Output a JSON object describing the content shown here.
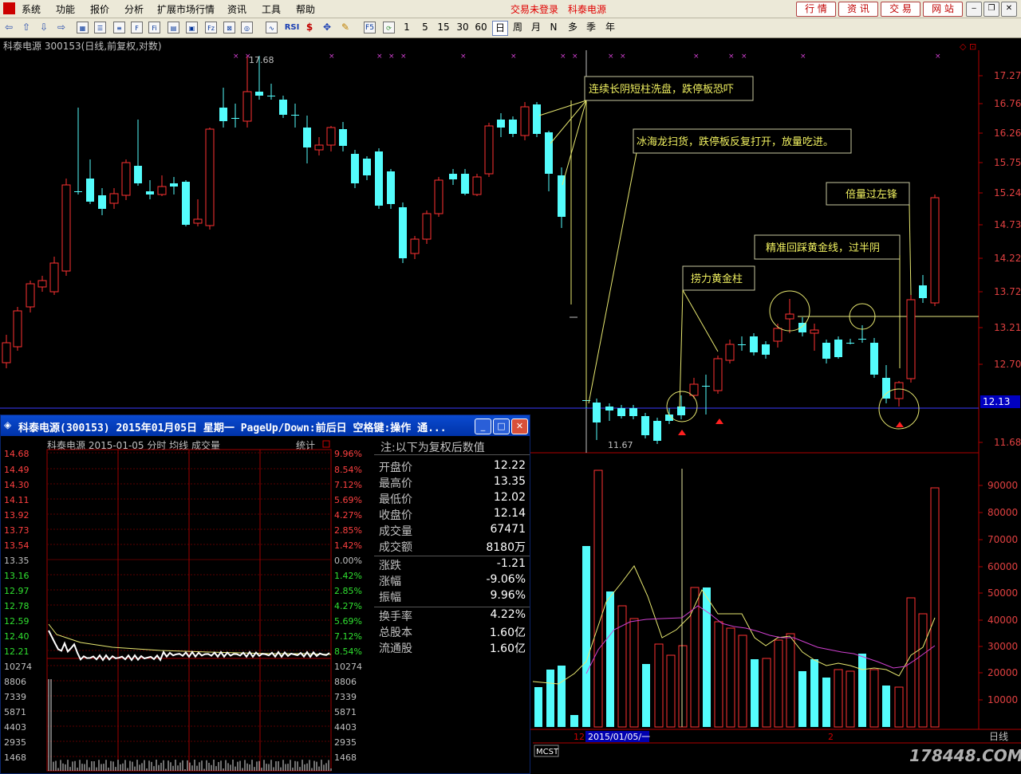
{
  "menu": {
    "items": [
      "系统",
      "功能",
      "报价",
      "分析",
      "扩展市场行情",
      "资讯",
      "工具",
      "帮助"
    ],
    "login_status": "交易未登录",
    "stock_name": "科泰电源",
    "nav": [
      "行 情",
      "资 讯",
      "交 易",
      "网 站"
    ]
  },
  "toolbar": {
    "periods": [
      "1",
      "5",
      "15",
      "30",
      "60",
      "日",
      "周",
      "月",
      "N",
      "多",
      "季",
      "年"
    ],
    "selected": "日",
    "rsi": "RSI",
    "f5": "F5"
  },
  "chart": {
    "header": "科泰电源 300153(日线,前复权,对数)",
    "price_axis": [
      "17.27",
      "16.76",
      "16.26",
      "15.75",
      "15.24",
      "14.73",
      "14.22",
      "13.72",
      "13.21",
      "12.70",
      "12.13",
      "11.68"
    ],
    "current_price": "12.13",
    "vol_axis": [
      "90000",
      "80000",
      "70000",
      "60000",
      "50000",
      "40000",
      "30000",
      "20000",
      "10000"
    ],
    "high_label": "17.68",
    "low_label": "11.67",
    "annotations": [
      "连续长阴短柱洗盘，跌停板恐吓",
      "冰海龙扫货，跌停板反复打开，放量吃进。",
      "捞力黄金柱",
      "精准回踩黄金线，过半阴",
      "倍量过左锋"
    ],
    "date_label": "2015/01/05/一",
    "axis_month_1": "12",
    "axis_month_2": "2",
    "period_label": "日线",
    "indicator": "MCST",
    "watermark": "178448.COM"
  },
  "chart_data": {
    "type": "candlestick",
    "title": "科泰电源 300153(日线,前复权,对数)",
    "ylim": [
      11.5,
      17.6
    ],
    "y_scale": "log",
    "price_levels": {
      "high": 17.68,
      "low": 11.67,
      "last": 12.13,
      "support_line": 13.4
    },
    "volume_ylim": [
      0,
      100000
    ]
  },
  "popup": {
    "title": "科泰电源(300153) 2015年01月05日 星期一 PageUp/Down:前后日 空格键:操作 通...",
    "subheader": "科泰电源   2015-01-05 分时 均线 成交量",
    "stats_label": "统计",
    "left_axis": [
      "14.68",
      "14.49",
      "14.30",
      "14.11",
      "13.92",
      "13.73",
      "13.54",
      "13.35",
      "13.16",
      "12.97",
      "12.78",
      "12.59",
      "12.40",
      "12.21",
      "10274",
      "8806",
      "7339",
      "5871",
      "4403",
      "2935",
      "1468"
    ],
    "right_axis": [
      "9.96%",
      "8.54%",
      "7.12%",
      "5.69%",
      "4.27%",
      "2.85%",
      "1.42%",
      "0.00%",
      "1.42%",
      "2.85%",
      "4.27%",
      "5.69%",
      "7.12%",
      "8.54%",
      "10274",
      "8806",
      "7339",
      "5871",
      "4403",
      "2935",
      "1468"
    ],
    "note": "注:以下为复权后数值",
    "rows1": [
      {
        "label": "开盘价",
        "value": "12.22"
      },
      {
        "label": "最高价",
        "value": "13.35"
      },
      {
        "label": "最低价",
        "value": "12.02"
      },
      {
        "label": "收盘价",
        "value": "12.14"
      },
      {
        "label": "成交量",
        "value": "67471"
      },
      {
        "label": "成交额",
        "value": "8180万"
      }
    ],
    "rows2": [
      {
        "label": "涨跌",
        "value": "-1.21"
      },
      {
        "label": "涨幅",
        "value": "-9.06%"
      },
      {
        "label": "振幅",
        "value": "9.96%"
      }
    ],
    "rows3": [
      {
        "label": "换手率",
        "value": "4.22%"
      },
      {
        "label": "总股本",
        "value": "1.60亿"
      },
      {
        "label": "流通股",
        "value": "1.60亿"
      }
    ]
  }
}
